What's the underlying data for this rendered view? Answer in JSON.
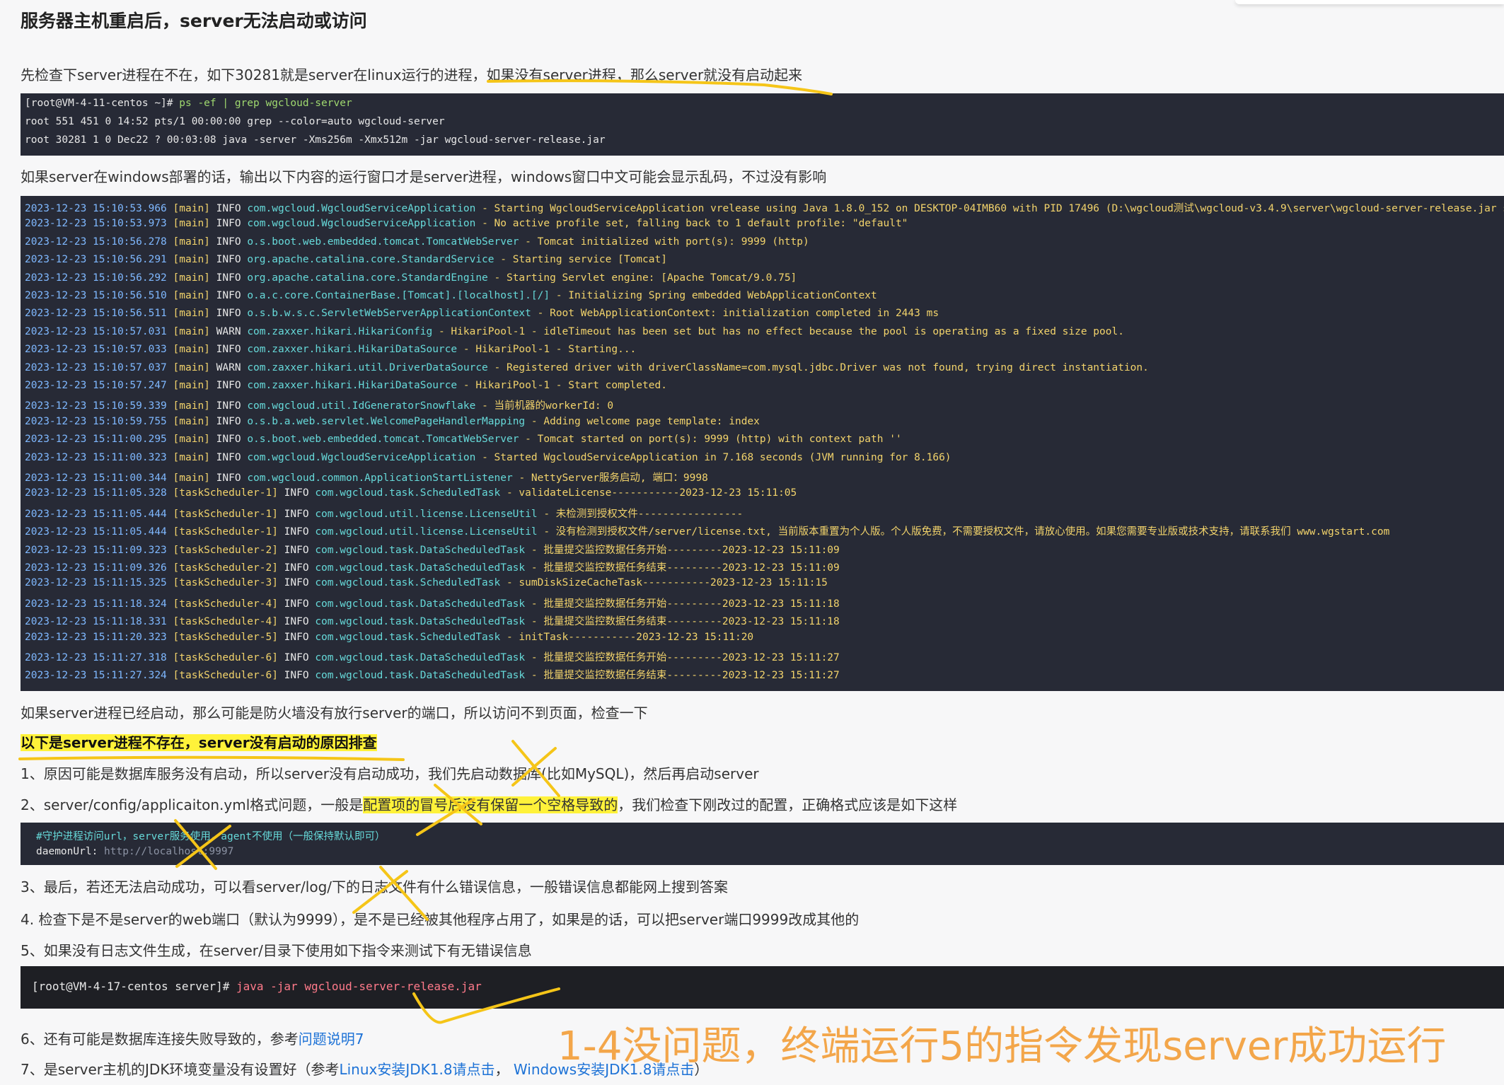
{
  "heading": "服务器主机重启后，server无法启动或访问",
  "p1": {
    "a": "先检查下server进程在不在，如下30281就是server在linux运行的进程，",
    "b": "如果没有server进程，那么server就没有启动起来"
  },
  "code1": [
    "[root@VM-4-11-centos ~]# ps -ef | grep wgcloud-server",
    "root       551   451  0 14:52 pts/1    00:00:00 grep --color=auto wgcloud-server",
    "root     30281     1  0 Dec22 ?        00:03:08 java -server -Xms256m -Xmx512m -jar wgcloud-server-release.jar"
  ],
  "p2": "如果server在windows部署的话，输出以下内容的运行窗口才是server进程，windows窗口中文可能会显示乱码，不过没有影响",
  "log": [
    {
      "ts": "2023-12-23 15:10:53.966",
      "th": "[main]",
      "lv": "INFO",
      "cls": "com.wgcloud.WgcloudServiceApplication",
      "msg": "- Starting WgcloudServiceApplication vrelease using Java 1.8.0_152 on DESKTOP-04IMB60 with PID 17496 (D:\\wgcloud测试\\wgcloud-v3.4.9\\server\\wgcloud-server-release.jar star"
    },
    {
      "ts": "2023-12-23 15:10:53.973",
      "th": "[main]",
      "lv": "INFO",
      "cls": "com.wgcloud.WgcloudServiceApplication",
      "msg": "- No active profile set, falling back to 1 default profile: \"default\""
    },
    {
      "ts": "2023-12-23 15:10:56.278",
      "th": "[main]",
      "lv": "INFO",
      "cls": "o.s.boot.web.embedded.tomcat.TomcatWebServer",
      "msg": "- Tomcat initialized with port(s): 9999 (http)"
    },
    {
      "ts": "2023-12-23 15:10:56.291",
      "th": "[main]",
      "lv": "INFO",
      "cls": "org.apache.catalina.core.StandardService",
      "msg": "- Starting service [Tomcat]"
    },
    {
      "ts": "2023-12-23 15:10:56.292",
      "th": "[main]",
      "lv": "INFO",
      "cls": "org.apache.catalina.core.StandardEngine",
      "msg": "- Starting Servlet engine: [Apache Tomcat/9.0.75]"
    },
    {
      "ts": "2023-12-23 15:10:56.510",
      "th": "[main]",
      "lv": "INFO",
      "cls": "o.a.c.core.ContainerBase.[Tomcat].[localhost].[/]",
      "msg": "- Initializing Spring embedded WebApplicationContext"
    },
    {
      "ts": "2023-12-23 15:10:56.511",
      "th": "[main]",
      "lv": "INFO",
      "cls": "o.s.b.w.s.c.ServletWebServerApplicationContext",
      "msg": "- Root WebApplicationContext: initialization completed in 2443 ms"
    },
    {
      "ts": "2023-12-23 15:10:57.031",
      "th": "[main]",
      "lv": "WARN",
      "cls": "com.zaxxer.hikari.HikariConfig",
      "msg": "- HikariPool-1 - idleTimeout has been set but has no effect because the pool is operating as a fixed size pool."
    },
    {
      "ts": "2023-12-23 15:10:57.033",
      "th": "[main]",
      "lv": "INFO",
      "cls": "com.zaxxer.hikari.HikariDataSource",
      "msg": "- HikariPool-1 - Starting..."
    },
    {
      "ts": "2023-12-23 15:10:57.037",
      "th": "[main]",
      "lv": "WARN",
      "cls": "com.zaxxer.hikari.util.DriverDataSource",
      "msg": "- Registered driver with driverClassName=com.mysql.jdbc.Driver was not found, trying direct instantiation."
    },
    {
      "ts": "2023-12-23 15:10:57.247",
      "th": "[main]",
      "lv": "INFO",
      "cls": "com.zaxxer.hikari.HikariDataSource",
      "msg": "- HikariPool-1 - Start completed."
    },
    {
      "ts": "2023-12-23 15:10:59.339",
      "th": "[main]",
      "lv": "INFO",
      "cls": "com.wgcloud.util.IdGeneratorSnowflake",
      "msg": "- 当前机器的workerId: 0"
    },
    {
      "ts": "2023-12-23 15:10:59.755",
      "th": "[main]",
      "lv": "INFO",
      "cls": "o.s.b.a.web.servlet.WelcomePageHandlerMapping",
      "msg": "- Adding welcome page template: index"
    },
    {
      "ts": "2023-12-23 15:11:00.295",
      "th": "[main]",
      "lv": "INFO",
      "cls": "o.s.boot.web.embedded.tomcat.TomcatWebServer",
      "msg": "- Tomcat started on port(s): 9999 (http) with context path ''"
    },
    {
      "ts": "2023-12-23 15:11:00.323",
      "th": "[main]",
      "lv": "INFO",
      "cls": "com.wgcloud.WgcloudServiceApplication",
      "msg": "- Started WgcloudServiceApplication in 7.168 seconds (JVM running for 8.166)"
    },
    {
      "ts": "2023-12-23 15:11:00.344",
      "th": "[main]",
      "lv": "INFO",
      "cls": "com.wgcloud.common.ApplicationStartListener",
      "msg": "- NettyServer服务启动, 端口：9998"
    },
    {
      "ts": "2023-12-23 15:11:05.328",
      "th": "[taskScheduler-1]",
      "lv": "INFO",
      "cls": "com.wgcloud.task.ScheduledTask",
      "msg": "- validateLicense-----------2023-12-23 15:11:05"
    },
    {
      "ts": "2023-12-23 15:11:05.444",
      "th": "[taskScheduler-1]",
      "lv": "INFO",
      "cls": "com.wgcloud.util.license.LicenseUtil",
      "msg": "- 未检测到授权文件-----------------"
    },
    {
      "ts": "2023-12-23 15:11:05.444",
      "th": "[taskScheduler-1]",
      "lv": "INFO",
      "cls": "com.wgcloud.util.license.LicenseUtil",
      "msg": "- 没有检测到授权文件/server/license.txt, 当前版本重置为个人版。个人版免费，不需要授权文件，请放心使用。如果您需要专业版或技术支持，请联系我们 www.wgstart.com"
    },
    {
      "ts": "2023-12-23 15:11:09.323",
      "th": "[taskScheduler-2]",
      "lv": "INFO",
      "cls": "com.wgcloud.task.DataScheduledTask",
      "msg": "- 批量提交监控数据任务开始---------2023-12-23 15:11:09"
    },
    {
      "ts": "2023-12-23 15:11:09.326",
      "th": "[taskScheduler-2]",
      "lv": "INFO",
      "cls": "com.wgcloud.task.DataScheduledTask",
      "msg": "- 批量提交监控数据任务结束---------2023-12-23 15:11:09"
    },
    {
      "ts": "2023-12-23 15:11:15.325",
      "th": "[taskScheduler-3]",
      "lv": "INFO",
      "cls": "com.wgcloud.task.ScheduledTask",
      "msg": "- sumDiskSizeCacheTask-----------2023-12-23 15:11:15"
    },
    {
      "ts": "2023-12-23 15:11:18.324",
      "th": "[taskScheduler-4]",
      "lv": "INFO",
      "cls": "com.wgcloud.task.DataScheduledTask",
      "msg": "- 批量提交监控数据任务开始---------2023-12-23 15:11:18"
    },
    {
      "ts": "2023-12-23 15:11:18.331",
      "th": "[taskScheduler-4]",
      "lv": "INFO",
      "cls": "com.wgcloud.task.DataScheduledTask",
      "msg": "- 批量提交监控数据任务结束---------2023-12-23 15:11:18"
    },
    {
      "ts": "2023-12-23 15:11:20.323",
      "th": "[taskScheduler-5]",
      "lv": "INFO",
      "cls": "com.wgcloud.task.ScheduledTask",
      "msg": "- initTask-----------2023-12-23 15:11:20"
    },
    {
      "ts": "2023-12-23 15:11:27.318",
      "th": "[taskScheduler-6]",
      "lv": "INFO",
      "cls": "com.wgcloud.task.DataScheduledTask",
      "msg": "- 批量提交监控数据任务开始---------2023-12-23 15:11:27"
    },
    {
      "ts": "2023-12-23 15:11:27.324",
      "th": "[taskScheduler-6]",
      "lv": "INFO",
      "cls": "com.wgcloud.task.DataScheduledTask",
      "msg": "- 批量提交监控数据任务结束---------2023-12-23 15:11:27"
    }
  ],
  "p3": "如果server进程已经启动，那么可能是防火墙没有放行server的端口，所以访问不到页面，检查一下",
  "p4": "以下是server进程不存在，server没有启动的原因排查",
  "step1": "1、原因可能是数据库服务没有启动，所以server没有启动成功，我们先启动数据库(比如MySQL)，然后再启动server",
  "step2": {
    "a": "2、server/config/applicaiton.yml格式问题，一般是",
    "b": "配置项的冒号后没有保留一个空格导致的",
    "c": "，我们检查下刚改过的配置，正确格式应该是如下这样"
  },
  "code2": {
    "comment": "#守护进程访问url，server服务使用，agent不使用（一般保持默认即可）",
    "key": "daemonUrl: ",
    "val": "http://localhost:9997"
  },
  "step3": "3、最后，若还无法启动成功，可以看server/log/下的日志文件有什么错误信息，一般错误信息都能网上搜到答案",
  "step4": "4. 检查下是不是server的web端口（默认为9999），是不是已经被其他程序占用了，如果是的话，可以把server端口9999改成其他的",
  "step5": "5、如果没有日志文件生成，在server/目录下使用如下指令来测试下有无错误信息",
  "code3": {
    "prompt": "[root@VM-4-17-centos server]# ",
    "cmd": "java -jar wgcloud-server-release.jar"
  },
  "step6": {
    "a": "6、还有可能是数据库连接失败导致的，参考",
    "link": "问题说明7"
  },
  "step7": {
    "a": "7、是server主机的JDK环境变量没有设置好（参考",
    "link1": "Linux安装JDK1.8请点击",
    "sep": "，  ",
    "link2": "Windows安装JDK1.8请点击",
    "b": "）"
  },
  "annotation": "1-4没问题，终端运行5的指令发现server成功运行",
  "colors": {
    "annotation": "#f3a64a",
    "highlight": "#fff23a",
    "link": "#1d72d6",
    "code_bg": "#272a36"
  }
}
